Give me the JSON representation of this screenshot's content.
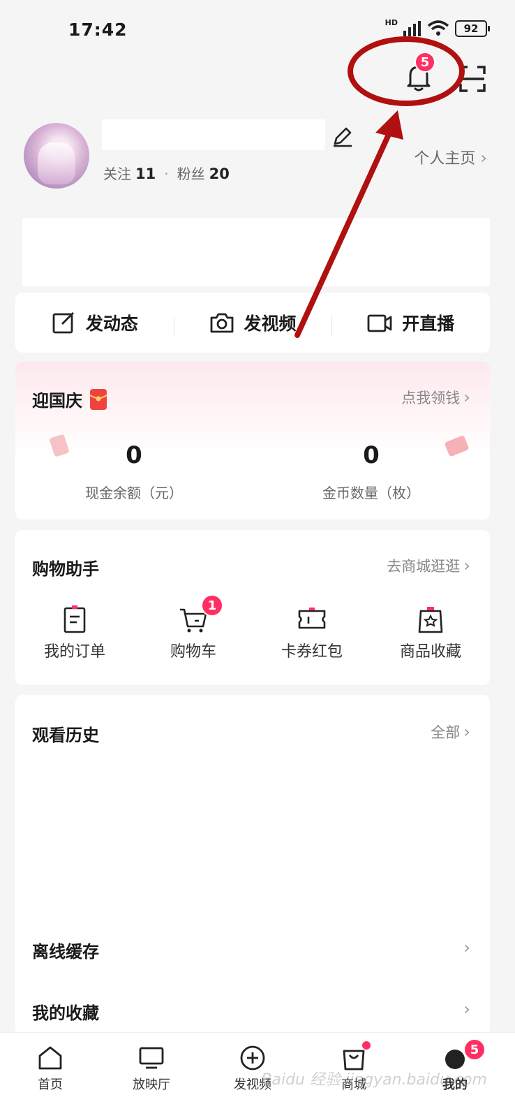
{
  "status_bar": {
    "time": "17:42",
    "network": "HD",
    "battery": "92"
  },
  "header": {
    "notification_count": "5"
  },
  "profile": {
    "following_label": "关注",
    "following_count": "11",
    "separator": "·",
    "followers_label": "粉丝",
    "followers_count": "20",
    "homepage_link": "个人主页",
    "chevron": "›"
  },
  "actions": [
    {
      "label": "发动态",
      "icon": "edit-square-icon"
    },
    {
      "label": "发视频",
      "icon": "camera-icon"
    },
    {
      "label": "开直播",
      "icon": "video-camera-icon"
    }
  ],
  "wallet": {
    "title": "迎国庆",
    "link": "点我领钱",
    "cash_value": "0",
    "cash_label": "现金余额（元）",
    "coins_value": "0",
    "coins_label": "金币数量（枚）"
  },
  "shopping": {
    "title": "购物助手",
    "link": "去商城逛逛",
    "items": [
      {
        "label": "我的订单",
        "icon": "order-icon"
      },
      {
        "label": "购物车",
        "icon": "cart-icon",
        "badge": "1"
      },
      {
        "label": "卡券红包",
        "icon": "coupon-icon"
      },
      {
        "label": "商品收藏",
        "icon": "star-bag-icon"
      }
    ]
  },
  "history": {
    "title": "观看历史",
    "link": "全部"
  },
  "menu": [
    {
      "label": "离线缓存"
    },
    {
      "label": "我的收藏"
    }
  ],
  "bottom_nav": [
    {
      "label": "首页",
      "icon": "home-icon"
    },
    {
      "label": "放映厅",
      "icon": "monitor-icon"
    },
    {
      "label": "发视频",
      "icon": "plus-circle-icon"
    },
    {
      "label": "商城",
      "icon": "shopping-bag-icon"
    },
    {
      "label": "我的",
      "icon": "avatar-icon",
      "badge": "5"
    }
  ],
  "watermark": "Baidu 经验 jingyan.baidu.com",
  "colors": {
    "accent": "#ff2e63",
    "annotation": "#b01010"
  }
}
